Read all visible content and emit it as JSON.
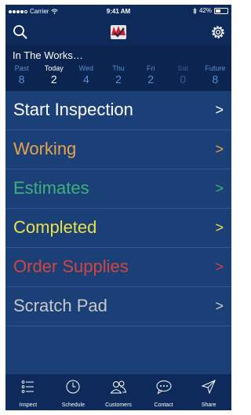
{
  "status_bar": {
    "carrier": "Carrier",
    "time": "9:41 AM",
    "battery": "42%"
  },
  "navbar": {
    "left_icon": "search-icon",
    "center_icon": "app-logo-icon",
    "right_icon": "gear-icon"
  },
  "week": {
    "title": "In The Works…",
    "days": [
      {
        "label": "Past",
        "value": "8"
      },
      {
        "label": "Today",
        "value": "2"
      },
      {
        "label": "Wed",
        "value": "4"
      },
      {
        "label": "Thu",
        "value": "2"
      },
      {
        "label": "Fri",
        "value": "2"
      },
      {
        "label": "Sat",
        "value": "0"
      },
      {
        "label": "Future",
        "value": "8"
      }
    ]
  },
  "menu": [
    {
      "label": "Start Inspection",
      "arrow": ">",
      "color": "#ffffff"
    },
    {
      "label": "Working",
      "arrow": ">",
      "color": "#e8a24a"
    },
    {
      "label": "Estimates",
      "arrow": ">",
      "color": "#3fb07a"
    },
    {
      "label": "Completed",
      "arrow": ">",
      "color": "#e8e04a"
    },
    {
      "label": "Order Supplies",
      "arrow": ">",
      "color": "#d2453f"
    },
    {
      "label": "Scratch Pad",
      "arrow": ">",
      "color": "#c8c8c8"
    }
  ],
  "tabs": [
    {
      "label": "Inspect",
      "icon": "list-icon"
    },
    {
      "label": "Schedule",
      "icon": "clock-icon"
    },
    {
      "label": "Customers",
      "icon": "people-icon"
    },
    {
      "label": "Contact",
      "icon": "chat-icon"
    },
    {
      "label": "Share",
      "icon": "send-icon"
    }
  ]
}
